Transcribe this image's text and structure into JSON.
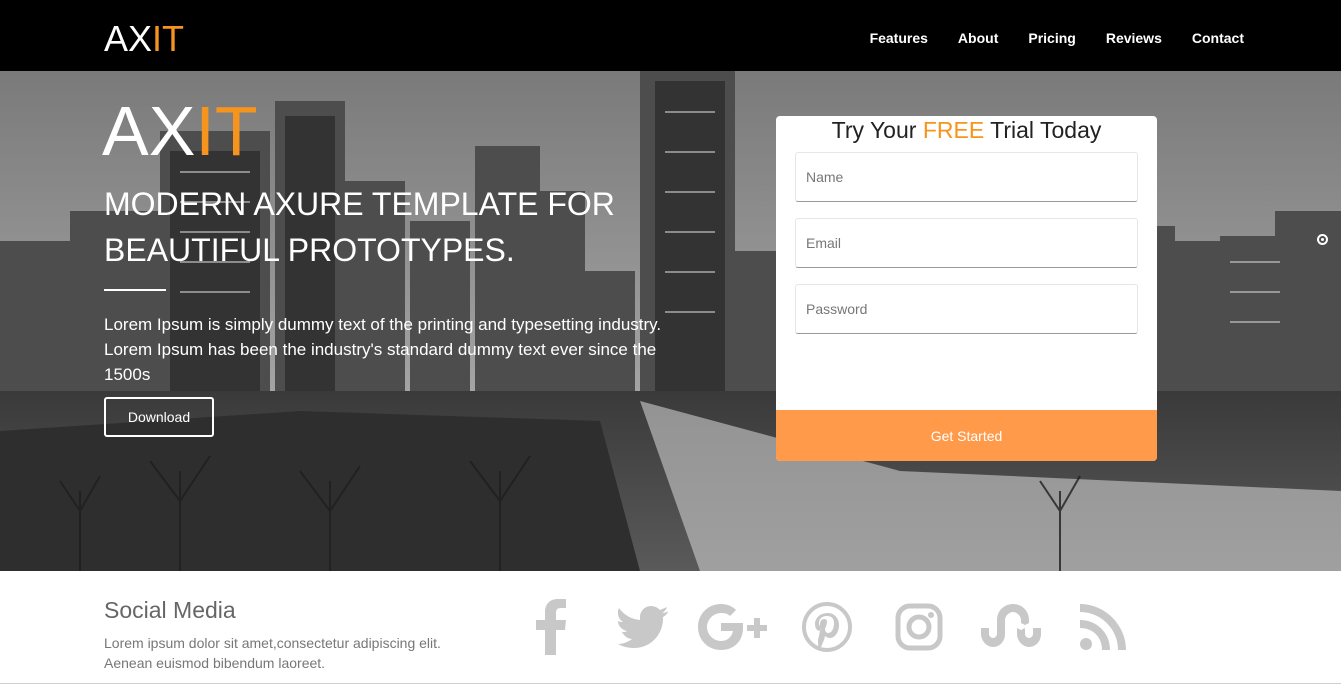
{
  "nav": {
    "logo_main": "AX",
    "logo_accent": "IT",
    "links": [
      "Features",
      "About",
      "Pricing",
      "Reviews",
      "Contact"
    ]
  },
  "hero": {
    "logo_main": "AX",
    "logo_accent": "IT",
    "title": "MODERN AXURE TEMPLATE FOR BEAUTIFUL PROTOTYPES.",
    "text": "Lorem Ipsum is simply dummy text of the printing and typesetting industry. Lorem Ipsum has been the industry's standard dummy text ever since the 1500s",
    "download_label": "Download"
  },
  "form": {
    "title_pre": "Try Your ",
    "title_accent": "FREE",
    "title_post": " Trial Today",
    "name_placeholder": "Name",
    "email_placeholder": "Email",
    "password_placeholder": "Password",
    "submit_label": "Get Started"
  },
  "social": {
    "title": "Social Media",
    "text": "Lorem ipsum dolor sit amet,consectetur adipiscing elit. Aenean euismod bibendum laoreet.",
    "icons": [
      "facebook-icon",
      "twitter-icon",
      "google-plus-icon",
      "pinterest-icon",
      "instagram-icon",
      "stumbleupon-icon",
      "rss-icon"
    ]
  },
  "colors": {
    "accent": "#f7941d",
    "button": "#ff9a4a",
    "nav_bg": "#000000",
    "icon_gray": "#c8c8c8"
  }
}
